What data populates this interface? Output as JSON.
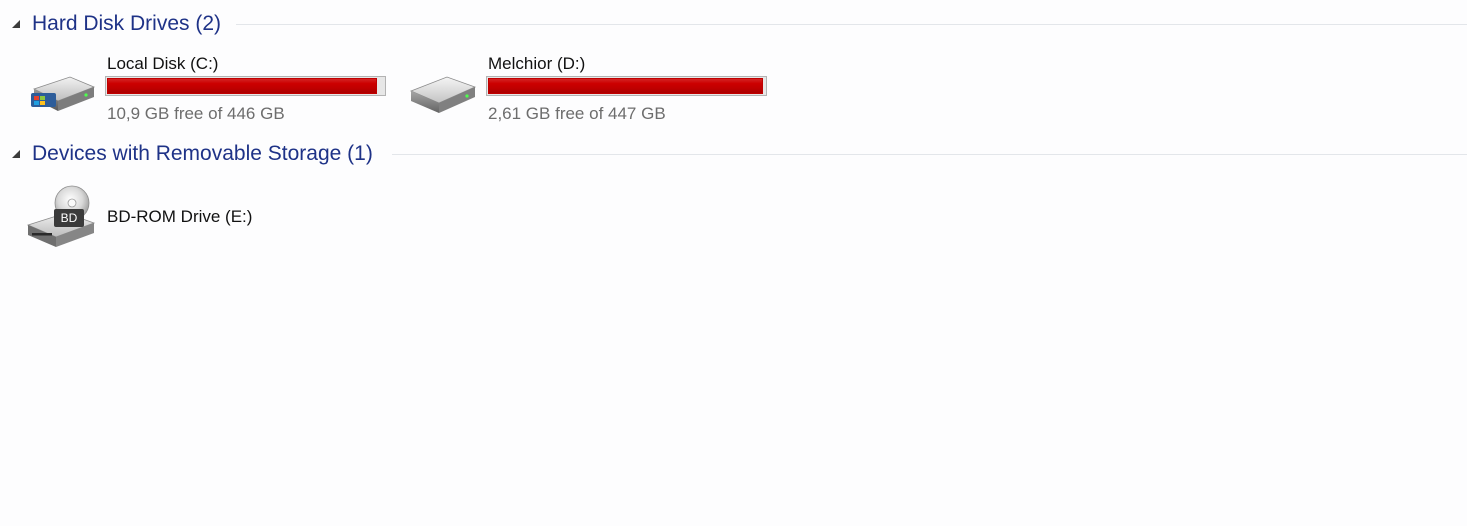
{
  "groups": [
    {
      "title": "Hard Disk Drives (2)",
      "drives": [
        {
          "name": "Local Disk (C:)",
          "free_text": "10,9 GB free of 446 GB",
          "used_fraction": 0.976,
          "icon": "system-hard-drive-icon"
        },
        {
          "name": "Melchior (D:)",
          "free_text": "2,61 GB free of 447 GB",
          "used_fraction": 0.994,
          "icon": "hard-drive-icon"
        }
      ]
    },
    {
      "title": "Devices with Removable Storage (1)",
      "drives": [
        {
          "name": "BD-ROM Drive (E:)",
          "icon": "bd-rom-drive-icon",
          "icon_badge": "BD"
        }
      ]
    }
  ],
  "colors": {
    "group_title": "#1e3287",
    "usage_bar_full": "#cc0000",
    "free_text": "#6d6d6d"
  }
}
